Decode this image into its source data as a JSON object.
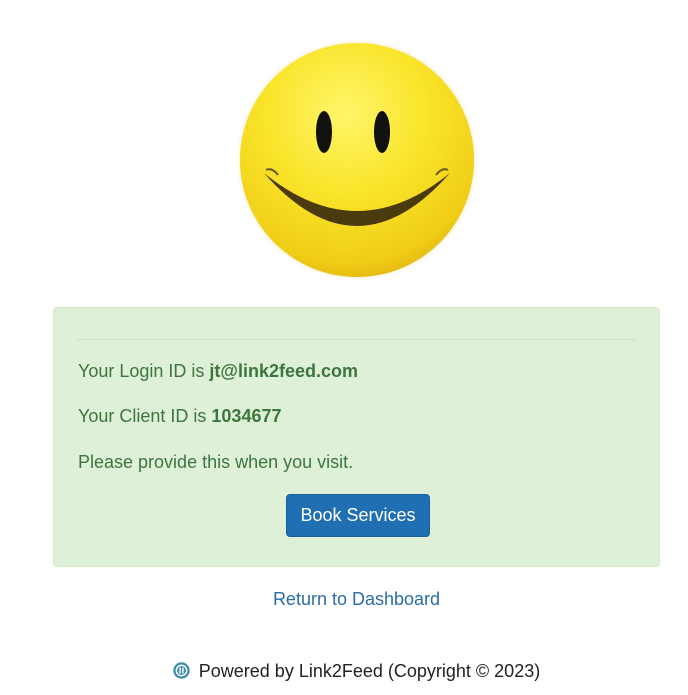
{
  "confirmation": {
    "login_prefix": "Your Login ID is ",
    "login_id": "jt@link2feed.com",
    "client_prefix": "Your Client ID is ",
    "client_id": "1034677",
    "instruction": "Please provide this when you visit.",
    "book_button_label": "Book Services"
  },
  "return_link_label": "Return to Dashboard",
  "footer": {
    "text": "Powered by Link2Feed (Copyright © 2023)",
    "logo_icon": "link2feed-logo-icon"
  },
  "colors": {
    "panel_bg": "#dff0d8",
    "success_text": "#3c763d",
    "button_bg": "#1f6fb2",
    "link": "#2a6ca8",
    "smiley_yellow": "#f7e02a"
  },
  "hero_icon": "smiley-face-icon"
}
